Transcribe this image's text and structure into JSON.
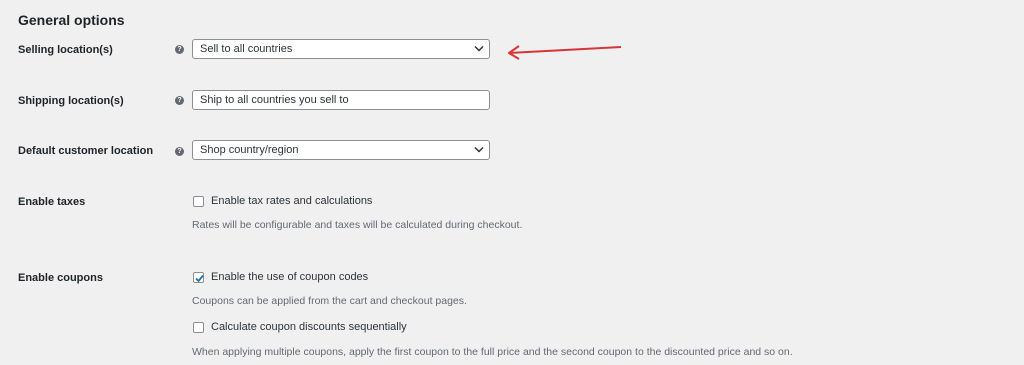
{
  "section_title": "General options",
  "selling": {
    "label": "Selling location(s)",
    "help": "?",
    "value": "Sell to all countries",
    "chevron_icon": "chevron-down-icon"
  },
  "shipping": {
    "label": "Shipping location(s)",
    "help": "?",
    "value": "Ship to all countries you sell to"
  },
  "default_location": {
    "label": "Default customer location",
    "help": "?",
    "value": "Shop country/region",
    "chevron_icon": "chevron-down-icon"
  },
  "taxes": {
    "label": "Enable taxes",
    "checkbox_label": "Enable tax rates and calculations",
    "checked": false,
    "description": "Rates will be configurable and taxes will be calculated during checkout."
  },
  "coupons": {
    "label": "Enable coupons",
    "option1_label": "Enable the use of coupon codes",
    "option1_checked": true,
    "option1_description": "Coupons can be applied from the cart and checkout pages.",
    "option2_label": "Calculate coupon discounts sequentially",
    "option2_checked": false,
    "option2_description": "When applying multiple coupons, apply the first coupon to the full price and the second coupon to the discounted price and so on."
  },
  "colors": {
    "background": "#f0f0f1",
    "annotation_arrow": "#d63638",
    "checkmark": "#2271b1"
  }
}
